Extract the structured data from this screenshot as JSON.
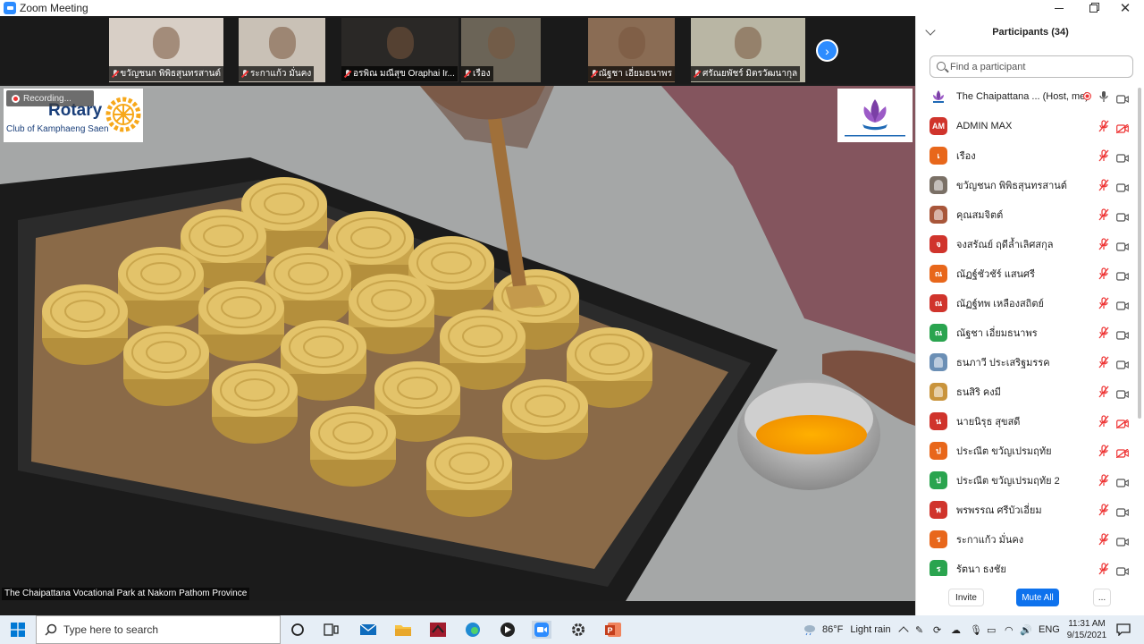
{
  "window": {
    "title": "Zoom Meeting"
  },
  "thumbnails": [
    {
      "name": "ขวัญชนก พิพิธสุนทรสานต์",
      "bg": "#d8cfc6"
    },
    {
      "name": "ระกาแก้ว มั่นคง",
      "bg": "#c9c1b6"
    },
    {
      "name": "อรพิณ มณีสุข Oraphai Ir...",
      "bg": "#2a2826"
    },
    {
      "name": "เรือง",
      "bg": "#6b6457"
    },
    {
      "name": "ณัฐชา เอี่ยมธนาพร",
      "bg": "#8a6c54"
    },
    {
      "name": "ศรัณยพัชร์ มิตรวัฒนากุล",
      "bg": "#b9b6a4"
    }
  ],
  "recording": {
    "label": "Recording..."
  },
  "logos": {
    "rotary_name": "Rotary",
    "rotary_club": "Club of Kamphaeng Saen",
    "rotary_color": "#1a3f7a",
    "rotary_gold": "#f7a81b"
  },
  "video": {
    "caption": "The Chaipattana Vocational Park at Nakorn Pathom Province"
  },
  "participants_panel": {
    "title": "Participants (34)",
    "search_placeholder": "Find a participant",
    "participants": [
      {
        "initials": "",
        "name": "The Chaipattana ... (Host, me)",
        "color": "#ffffff",
        "mic": "on",
        "cam": "on",
        "host": true
      },
      {
        "initials": "AM",
        "name": "ADMIN MAX",
        "color": "#d0342c",
        "mic": "muted",
        "cam": "off"
      },
      {
        "initials": "เ",
        "name": "เรือง",
        "color": "#e8671b",
        "mic": "muted",
        "cam": "on"
      },
      {
        "initials": "",
        "name": "ขวัญชนก พิพิธสุนทรสานต์",
        "color": "#7a7066",
        "mic": "muted",
        "cam": "on"
      },
      {
        "initials": "",
        "name": "คุณสมจิตต์",
        "color": "#a8563a",
        "mic": "muted",
        "cam": "on"
      },
      {
        "initials": "จ",
        "name": "จงสรัณย์ ฤดีล้ำเลิศสกุล",
        "color": "#d0342c",
        "mic": "muted",
        "cam": "on"
      },
      {
        "initials": "ณ",
        "name": "ณัฏฐ์ชัวชัร์ แสนศรี",
        "color": "#e8671b",
        "mic": "muted",
        "cam": "on"
      },
      {
        "initials": "ณ",
        "name": "ณัฏฐ์ทพ เหลืองสถิตย์",
        "color": "#d0342c",
        "mic": "muted",
        "cam": "on"
      },
      {
        "initials": "ณ",
        "name": "ณัฐชา เอี่ยมธนาพร",
        "color": "#2aa44f",
        "mic": "muted",
        "cam": "on"
      },
      {
        "initials": "",
        "name": "ธนภาวี ประเสริฐมรรค",
        "color": "#6b8fb5",
        "mic": "muted",
        "cam": "on"
      },
      {
        "initials": "",
        "name": "ธนสิริ คงมี",
        "color": "#c9943c",
        "mic": "muted",
        "cam": "on"
      },
      {
        "initials": "น",
        "name": "นายนิรุธ สุขสดี",
        "color": "#d0342c",
        "mic": "muted",
        "cam": "off"
      },
      {
        "initials": "ป",
        "name": "ประณีต ขวัญเปรมฤทัย",
        "color": "#e8671b",
        "mic": "muted",
        "cam": "off"
      },
      {
        "initials": "ป",
        "name": "ประณีต ขวัญเปรมฤทัย 2",
        "color": "#2aa44f",
        "mic": "muted",
        "cam": "on"
      },
      {
        "initials": "พ",
        "name": "พรพรรณ ศรีบัวเอี่ยม",
        "color": "#d0342c",
        "mic": "muted",
        "cam": "on"
      },
      {
        "initials": "ร",
        "name": "ระกาแก้ว มั่นคง",
        "color": "#e8671b",
        "mic": "muted",
        "cam": "on"
      },
      {
        "initials": "ร",
        "name": "รัตนา ธงชัย",
        "color": "#2aa44f",
        "mic": "muted",
        "cam": "on"
      }
    ],
    "invite_label": "Invite",
    "mute_all_label": "Mute All",
    "more_label": "...",
    "accent": "#0e72ed"
  },
  "taskbar": {
    "search_placeholder": "Type here to search",
    "weather_temp": "86°F",
    "weather_desc": "Light rain",
    "language": "ENG",
    "time": "11:31 AM",
    "date": "9/15/2021"
  }
}
